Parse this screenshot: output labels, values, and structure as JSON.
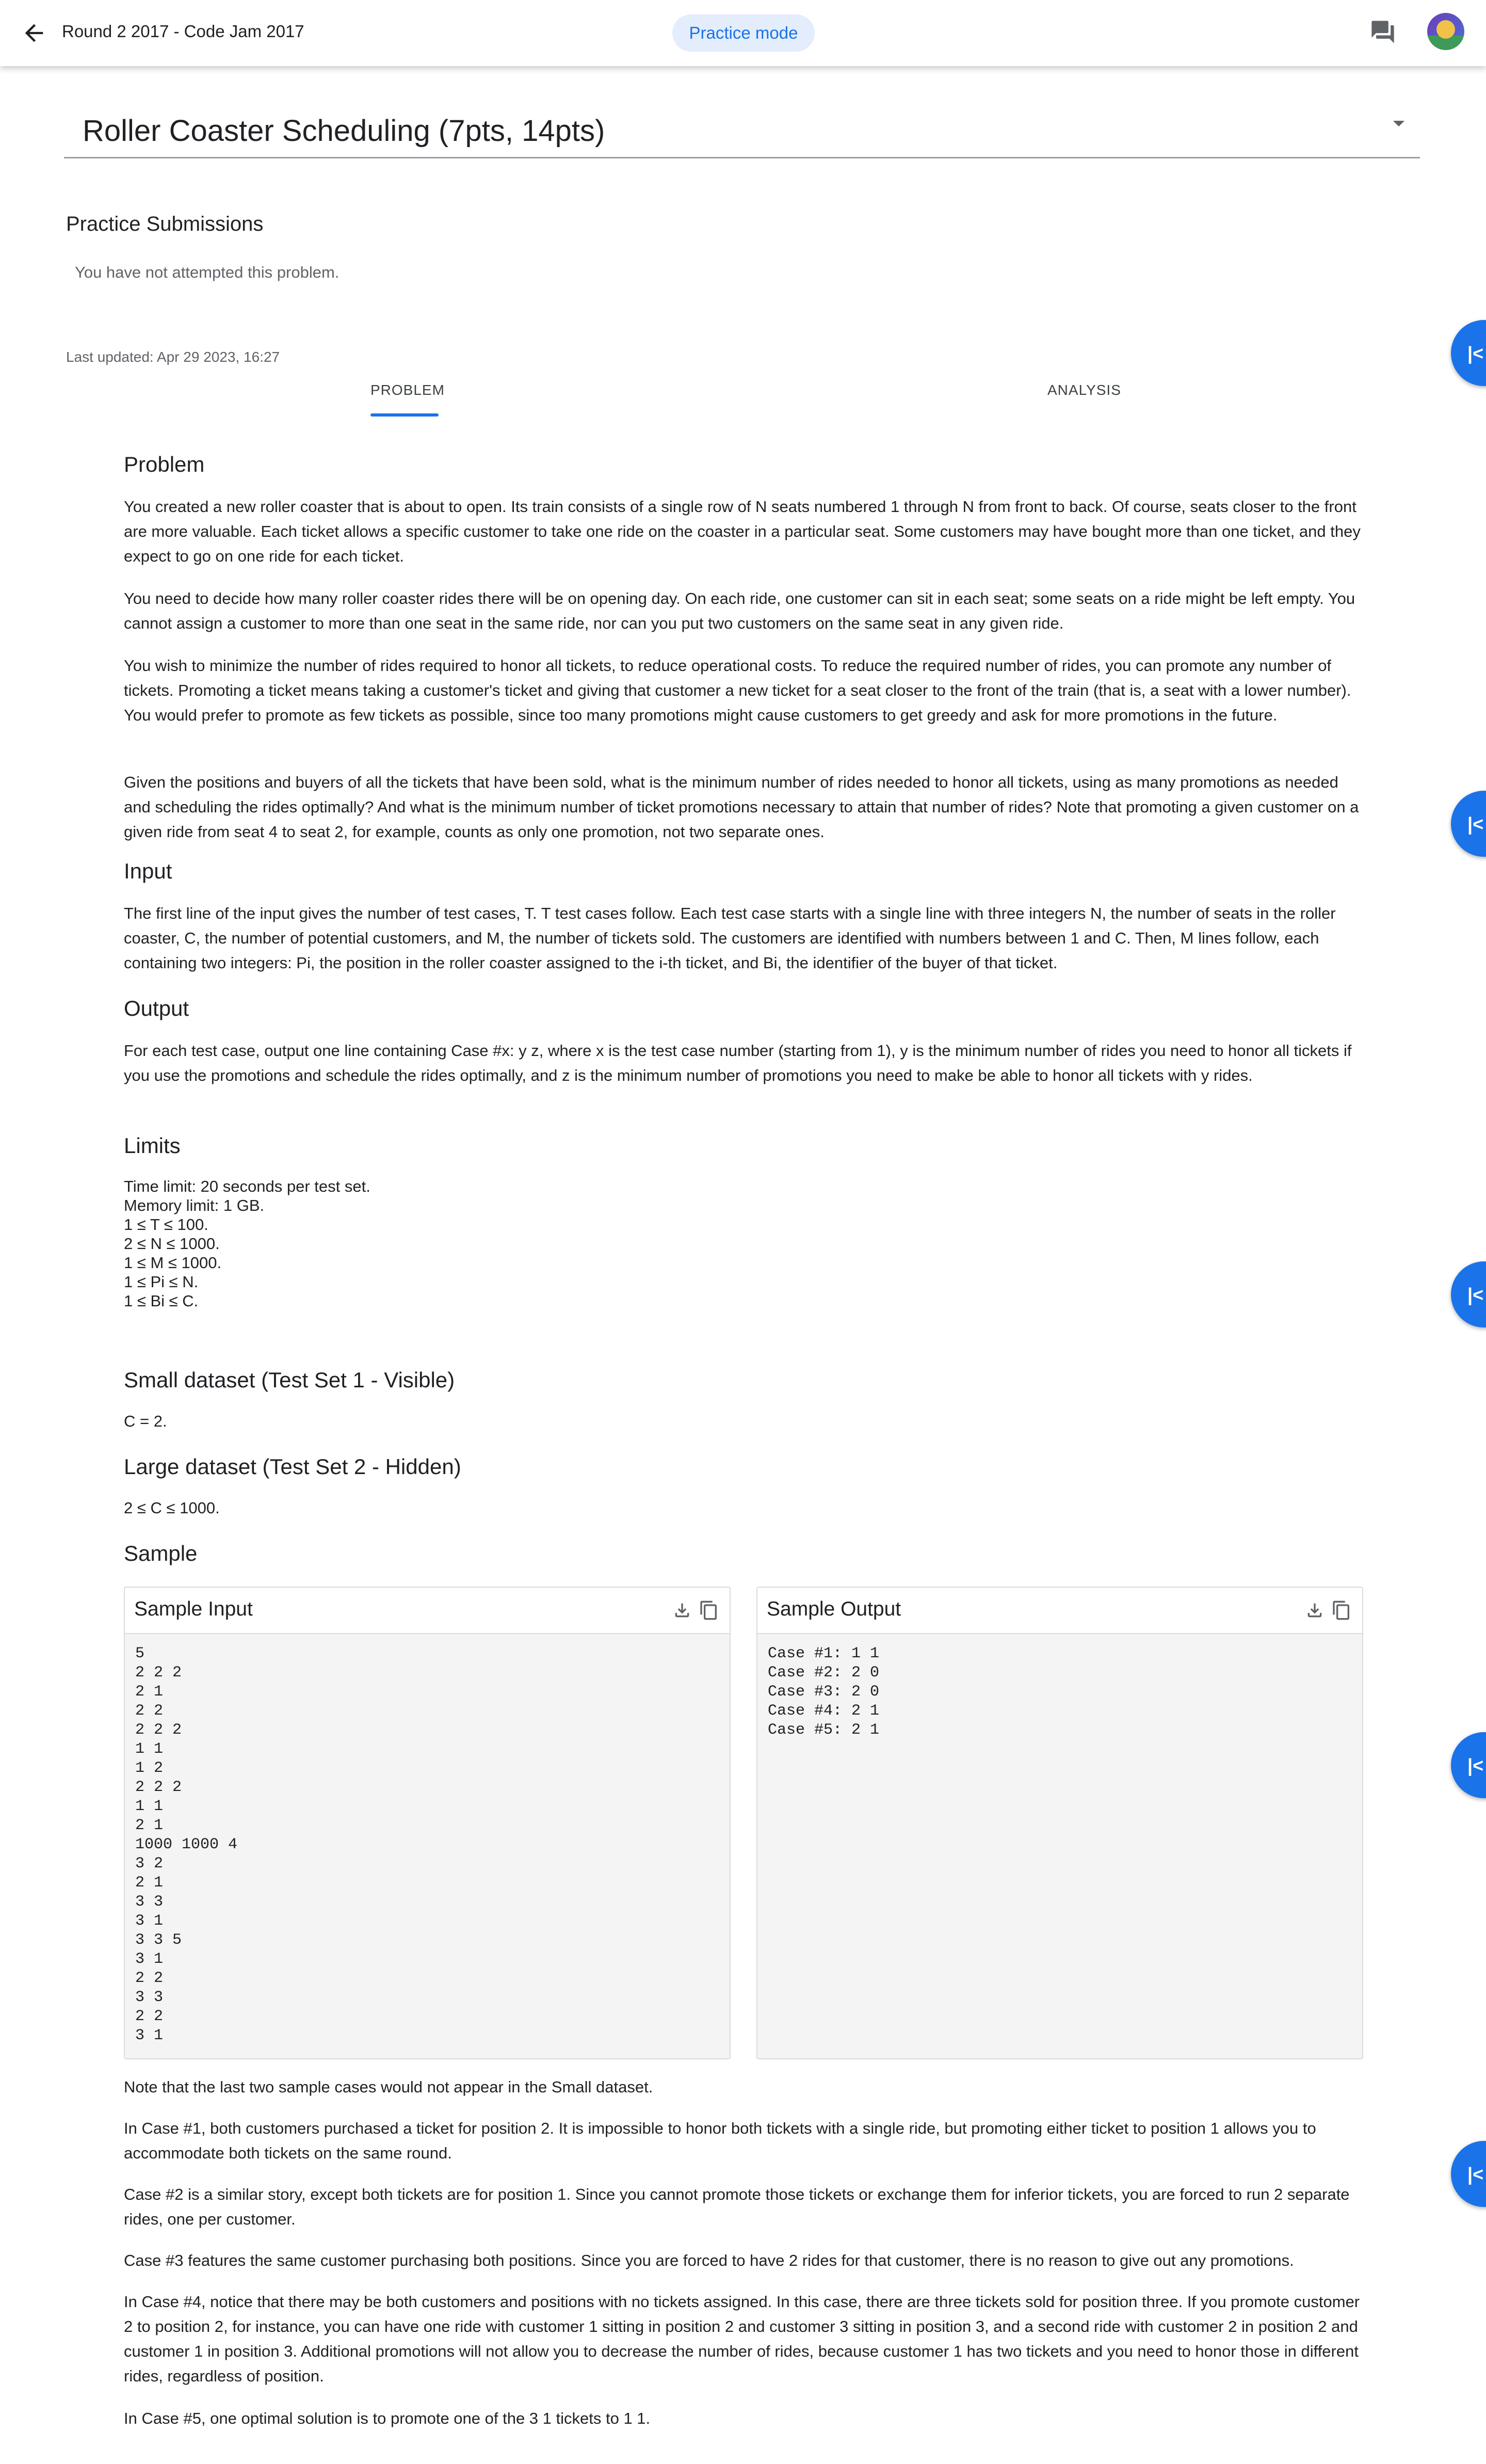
{
  "header": {
    "breadcrumb": "Round 2 2017 - Code Jam 2017",
    "mode": "Practice mode"
  },
  "problem_select": {
    "title": "Roller Coaster Scheduling (7pts, 14pts)"
  },
  "submissions": {
    "heading": "Practice Submissions",
    "empty_text": "You have not attempted this problem."
  },
  "last_updated": "Last updated: Apr 29 2023, 16:27",
  "tabs": [
    "PROBLEM",
    "ANALYSIS"
  ],
  "sections": {
    "problem_h": "Problem",
    "p1": "You created a new roller coaster that is about to open. Its train consists of a single row of N seats numbered 1 through N from front to back. Of course, seats closer to the front are more valuable. Each ticket allows a specific customer to take one ride on the coaster in a particular seat. Some customers may have bought more than one ticket, and they expect to go on one ride for each ticket.",
    "p2": "You need to decide how many roller coaster rides there will be on opening day. On each ride, one customer can sit in each seat; some seats on a ride might be left empty. You cannot assign a customer to more than one seat in the same ride, nor can you put two customers on the same seat in any given ride.",
    "p3": "You wish to minimize the number of rides required to honor all tickets, to reduce operational costs. To reduce the required number of rides, you can promote any number of tickets. Promoting a ticket means taking a customer's ticket and giving that customer a new ticket for a seat closer to the front of the train (that is, a seat with a lower number). You would prefer to promote as few tickets as possible, since too many promotions might cause customers to get greedy and ask for more promotions in the future.",
    "p4": "Given the positions and buyers of all the tickets that have been sold, what is the minimum number of rides needed to honor all tickets, using as many promotions as needed and scheduling the rides optimally? And what is the minimum number of ticket promotions necessary to attain that number of rides? Note that promoting a given customer on a given ride from seat 4 to seat 2, for example, counts as only one promotion, not two separate ones.",
    "input_h": "Input",
    "input_p": "The first line of the input gives the number of test cases, T. T test cases follow. Each test case starts with a single line with three integers N, the number of seats in the roller coaster, C, the number of potential customers, and M, the number of tickets sold. The customers are identified with numbers between 1 and C. Then, M lines follow, each containing two integers: Pi, the position in the roller coaster assigned to the i-th ticket, and Bi, the identifier of the buyer of that ticket.",
    "output_h": "Output",
    "output_p": "For each test case, output one line containing Case #x: y z, where x is the test case number (starting from 1), y is the minimum number of rides you need to honor all tickets if you use the promotions and schedule the rides optimally, and z is the minimum number of promotions you need to make be able to honor all tickets with y rides.",
    "limits_h": "Limits",
    "limits": [
      "Time limit: 20 seconds per test set.",
      "Memory limit: 1 GB.",
      "1 ≤ T ≤ 100.",
      "2 ≤ N ≤ 1000.",
      "1 ≤ M ≤ 1000.",
      "1 ≤ Pi ≤ N.",
      "1 ≤ Bi ≤ C."
    ],
    "small_h": "Small dataset (Test Set 1 - Visible)",
    "small_p": "C = 2.",
    "large_h": "Large dataset (Test Set 2 - Hidden)",
    "large_p": "2 ≤ C ≤ 1000.",
    "sample_h": "Sample",
    "sample_input_label": "Sample Input",
    "sample_output_label": "Sample Output",
    "sample_input": "5\n2 2 2\n2 1\n2 2\n2 2 2\n1 1\n1 2\n2 2 2\n1 1\n2 1\n1000 1000 4\n3 2\n2 1\n3 3\n3 1\n3 3 5\n3 1\n2 2\n3 3\n2 2\n3 1",
    "sample_output": "Case #1: 1 1\nCase #2: 2 0\nCase #3: 2 0\nCase #4: 2 1\nCase #5: 2 1",
    "n1": "Note that the last two sample cases would not appear in the Small dataset.",
    "n2": "In Case #1, both customers purchased a ticket for position 2. It is impossible to honor both tickets with a single ride, but promoting either ticket to position 1 allows you to accommodate both tickets on the same round.",
    "n3": "Case #2 is a similar story, except both tickets are for position 1. Since you cannot promote those tickets or exchange them for inferior tickets, you are forced to run 2 separate rides, one per customer.",
    "n4": "Case #3 features the same customer purchasing both positions. Since you are forced to have 2 rides for that customer, there is no reason to give out any promotions.",
    "n5": "In Case #4, notice that there may be both customers and positions with no tickets assigned. In this case, there are three tickets sold for position three. If you promote customer 2 to position 2, for instance, you can have one ride with customer 1 sitting in position 2 and customer 3 sitting in position 3, and a second ride with customer 2 in position 2 and customer 1 in position 3. Additional promotions will not allow you to decrease the number of rides, because customer 1 has two tickets and you need to honor those in different rides, regardless of position.",
    "n6": "In Case #5, one optimal solution is to promote one of the 3 1 tickets to 1 1."
  }
}
